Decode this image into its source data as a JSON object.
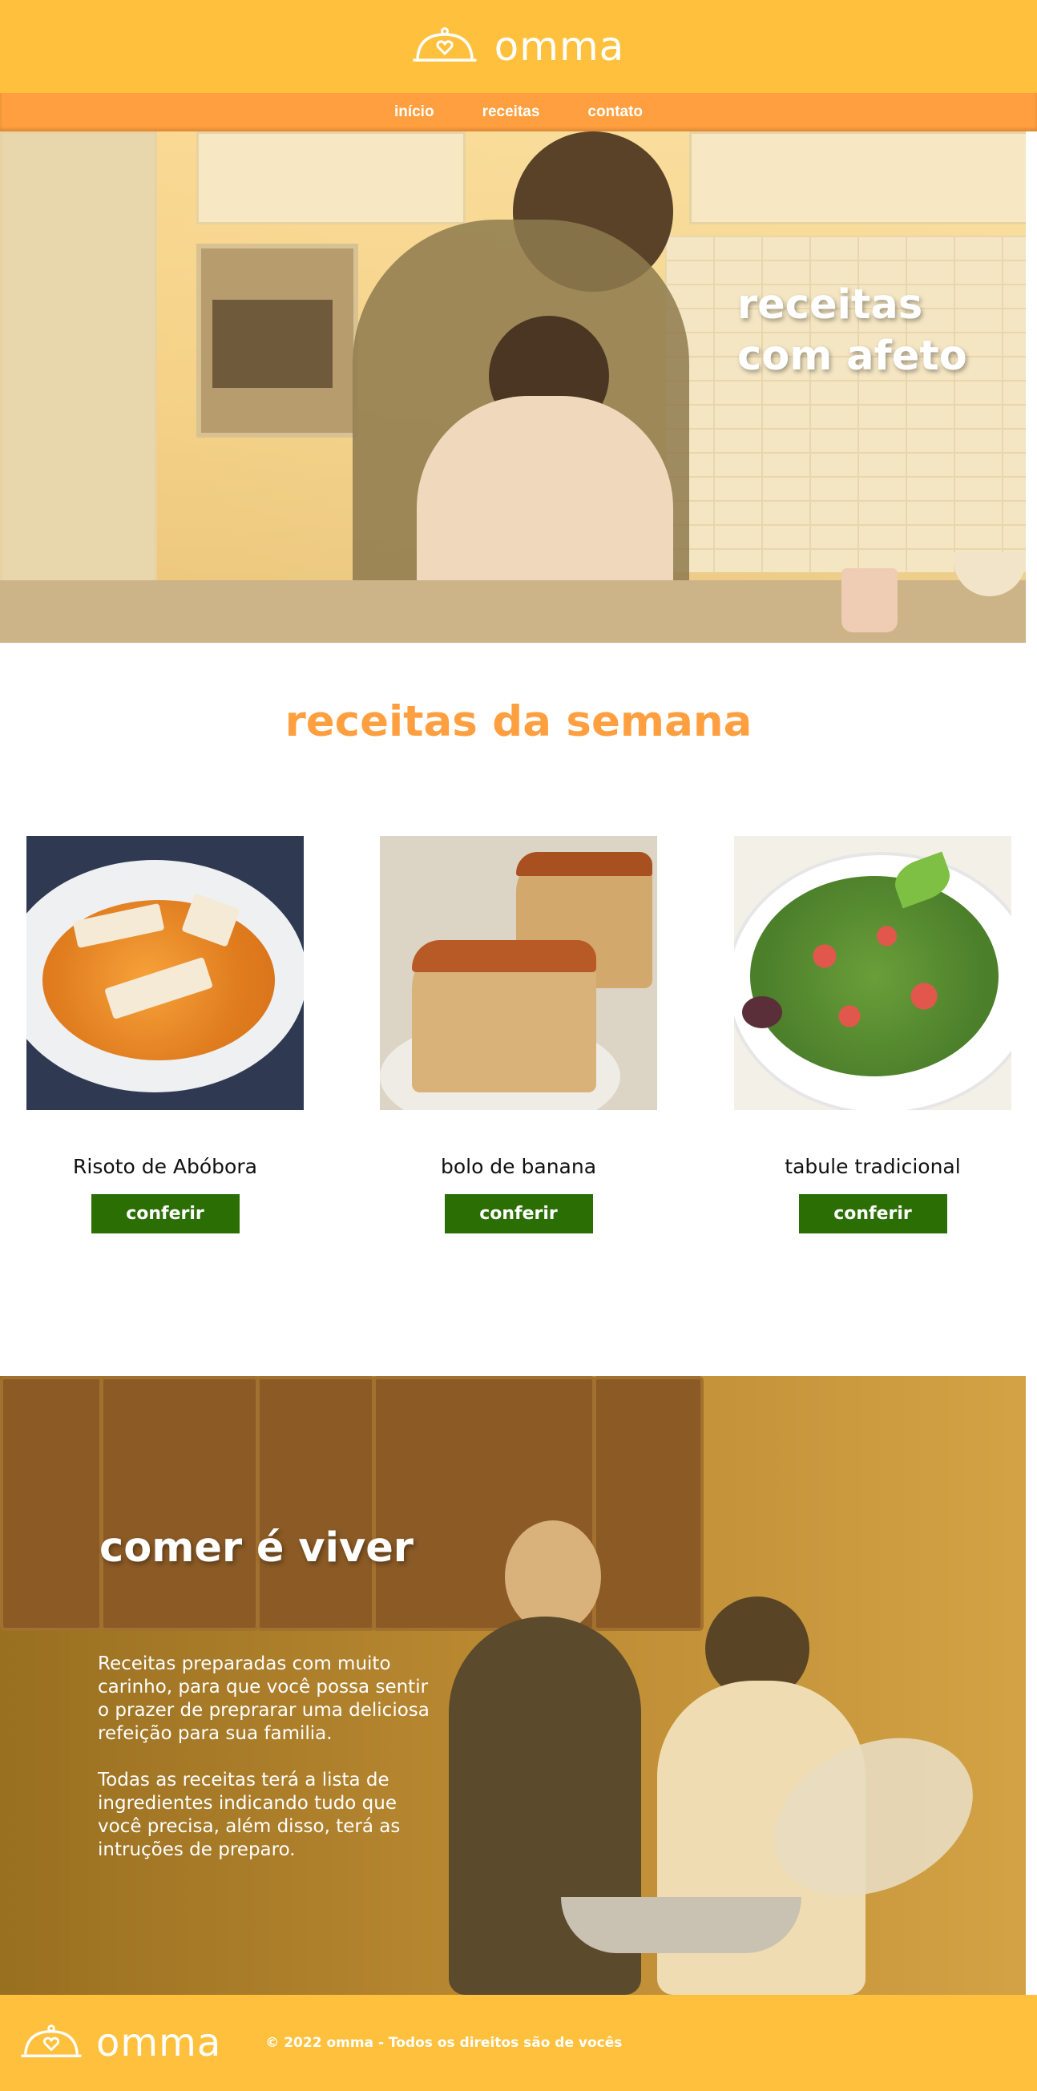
{
  "brand": {
    "name": "omma",
    "icon": "cloche-heart-icon",
    "colors": {
      "header": "#ffc13d",
      "nav": "#ff9f3f",
      "accent": "#ff9f3f",
      "button": "#2a6e04"
    }
  },
  "nav": {
    "items": [
      {
        "label": "início"
      },
      {
        "label": "receitas"
      },
      {
        "label": "contato"
      }
    ]
  },
  "hero": {
    "title_line1": "receitas",
    "title_line2": "com afeto"
  },
  "weekly": {
    "title": "receitas da semana",
    "recipes": [
      {
        "name": "Risoto de Abóbora",
        "button": "conferir"
      },
      {
        "name": "bolo de banana",
        "button": "conferir"
      },
      {
        "name": "tabule tradicional",
        "button": "conferir"
      }
    ]
  },
  "banner": {
    "title": "comer é viver",
    "paragraph1": "Receitas preparadas com muito carinho, para que você possa sentir o prazer de preprarar uma deliciosa refeição para sua familia.",
    "paragraph2": "Todas as receitas terá a lista de ingredientes indicando tudo que você precisa, além disso, terá as intruções de preparo."
  },
  "footer": {
    "copyright": "© 2022 omma - Todos os direitos são de vocês"
  }
}
